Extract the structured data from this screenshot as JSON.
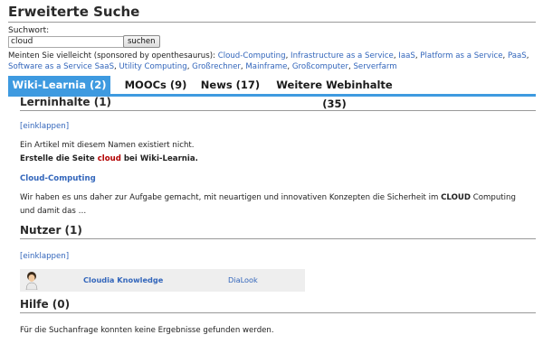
{
  "page": {
    "title": "Erweiterte Suche"
  },
  "search": {
    "label": "Suchwort:",
    "value": "cloud",
    "button": "suchen"
  },
  "suggestions": {
    "prefix": "Meinten Sie vielleicht (sponsored by openthesaurus): ",
    "items": [
      "Cloud-Computing",
      "Infrastructure as a Service",
      "IaaS",
      "Platform as a Service",
      "PaaS",
      "Software as a Service SaaS",
      "Utility Computing",
      "Großrechner",
      "Mainframe",
      "Großcomputer",
      "Serverfarm"
    ]
  },
  "tabs": [
    {
      "label": "Wiki-Learnia (2)",
      "active": true
    },
    {
      "label": "MOOCs (9)",
      "active": false
    },
    {
      "label": "News (17)",
      "active": false
    },
    {
      "label": "Weitere Webinhalte (35)",
      "active": false
    }
  ],
  "lerninhalte": {
    "title": "Lerninhalte (1)",
    "collapse": "[einklappen]",
    "not_exist": "Ein Artikel mit diesem Namen existiert nicht.",
    "create_prefix": "Erstelle die Seite ",
    "create_term": "cloud",
    "create_suffix": " bei Wiki-Learnia.",
    "result_title": "Cloud-Computing",
    "snippet_a": "Wir haben es uns daher zur Aufgabe gemacht, mit neuartigen und innovativen Konzepten die Sicherheit im ",
    "snippet_bold": "CLOUD",
    "snippet_b": " Computing",
    "snippet_line2": "und damit das …"
  },
  "nutzer": {
    "title": "Nutzer (1)",
    "collapse": "[einklappen]",
    "user_name": "Cloudia Knowledge",
    "user_extra": "DiaLook"
  },
  "hilfe": {
    "title": "Hilfe (0)",
    "text": "Für die Suchanfrage konnten keine Ergebnisse gefunden werden."
  },
  "colors": {
    "accent": "#3e9ae0",
    "link": "#3366bb",
    "highlight": "#b30000"
  }
}
